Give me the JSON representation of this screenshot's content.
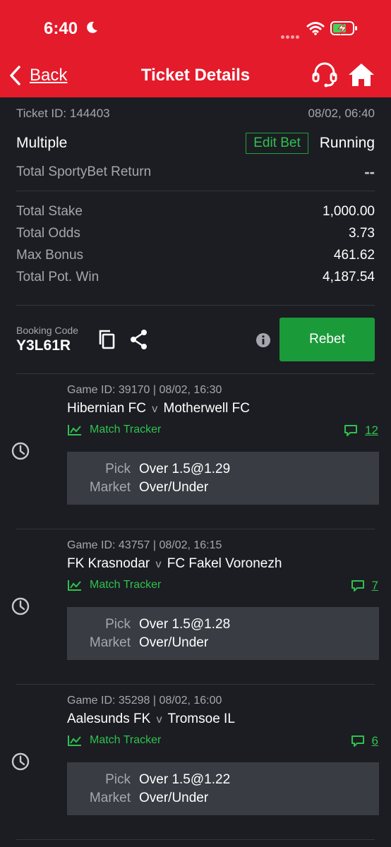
{
  "status_bar": {
    "time": "6:40"
  },
  "nav": {
    "back_label": "Back",
    "title": "Ticket Details"
  },
  "ticket": {
    "id_text": "Ticket ID: 144403",
    "datetime": "08/02, 06:40",
    "bet_type": "Multiple",
    "edit_bet_label": "Edit Bet",
    "status": "Running",
    "sporty_return_label": "Total SportyBet Return",
    "sporty_return_value": "--"
  },
  "summary": [
    {
      "label": "Total Stake",
      "value": "1,000.00"
    },
    {
      "label": "Total Odds",
      "value": "3.73"
    },
    {
      "label": "Max Bonus",
      "value": "461.62"
    },
    {
      "label": "Total Pot. Win",
      "value": "4,187.54"
    }
  ],
  "booking": {
    "label": "Booking Code",
    "code": "Y3L61R",
    "rebet_label": "Rebet"
  },
  "games": [
    {
      "game_id": "Game ID: 39170 | 08/02, 16:30",
      "home": "Hibernian FC",
      "sep": "v",
      "away": "Motherwell FC",
      "tracker_label": "Match Tracker",
      "comments": "12",
      "pick_label": "Pick",
      "pick_value": "Over 1.5@1.29",
      "market_label": "Market",
      "market_value": "Over/Under"
    },
    {
      "game_id": "Game ID: 43757 | 08/02, 16:15",
      "home": "FK Krasnodar",
      "sep": "v",
      "away": "FC Fakel Voronezh",
      "tracker_label": "Match Tracker",
      "comments": "7",
      "pick_label": "Pick",
      "pick_value": "Over 1.5@1.28",
      "market_label": "Market",
      "market_value": "Over/Under"
    },
    {
      "game_id": "Game ID: 35298 | 08/02, 16:00",
      "home": "Aalesunds FK",
      "sep": "v",
      "away": "Tromsoe IL",
      "tracker_label": "Match Tracker",
      "comments": "6",
      "pick_label": "Pick",
      "pick_value": "Over 1.5@1.22",
      "market_label": "Market",
      "market_value": "Over/Under"
    }
  ],
  "colors": {
    "header": "#e41b2b",
    "background": "#1b1d22",
    "accent_green": "#2fc14f",
    "rebet_green": "#1b9a3a",
    "pick_box": "#393c43"
  },
  "icons": [
    "moon-icon",
    "signal-icon",
    "wifi-icon",
    "battery-charging-icon",
    "back-chevron-icon",
    "support-headset-icon",
    "home-icon",
    "copy-icon",
    "share-icon",
    "info-icon",
    "clock-icon",
    "chart-line-icon",
    "comment-icon"
  ]
}
